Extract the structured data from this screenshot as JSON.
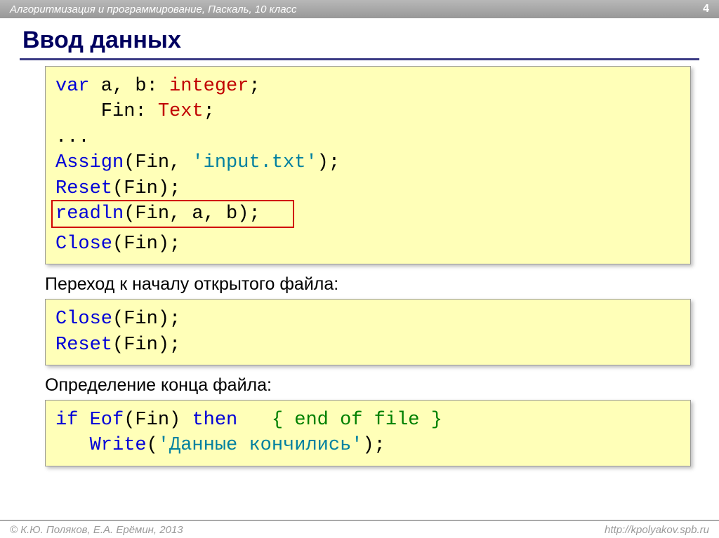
{
  "header": {
    "breadcrumb": "Алгоритмизация и программирование, Паскаль, 10 класс",
    "page": "4"
  },
  "title": "Ввод данных",
  "code1": {
    "l1_var": "var",
    "l1_rest": " a, b: ",
    "l1_type": "integer",
    "l1_semi": ";",
    "l2_pad": "    Fin: ",
    "l2_type": "Text",
    "l2_semi": ";",
    "l3": "...",
    "l4_func": "Assign",
    "l4_open": "(Fin, ",
    "l4_str": "'input.txt'",
    "l4_close": ");",
    "l5_func": "Reset",
    "l5_args": "(Fin);",
    "l6_func": "readln",
    "l6_args": "(Fin, a, b);",
    "l7_func": "Close",
    "l7_args": "(Fin);"
  },
  "desc1": "Переход к началу открытого файла:",
  "code2": {
    "l1_func": "Close",
    "l1_args": "(Fin);",
    "l2_func": "Reset",
    "l2_args": "(Fin);"
  },
  "desc2": "Определение конца файла:",
  "code3": {
    "l1_if": "if",
    "l1_mid1": " ",
    "l1_eof": "Eof",
    "l1_mid2": "(Fin) ",
    "l1_then": "then",
    "l1_sp": "   ",
    "l1_comment": "{ end of file }",
    "l2_pad": "   ",
    "l2_write": "Write",
    "l2_open": "(",
    "l2_str": "'Данные кончились'",
    "l2_close": ");"
  },
  "footer": {
    "left": "© К.Ю. Поляков, Е.А. Ерёмин, 2013",
    "right": "http://kpolyakov.spb.ru"
  }
}
